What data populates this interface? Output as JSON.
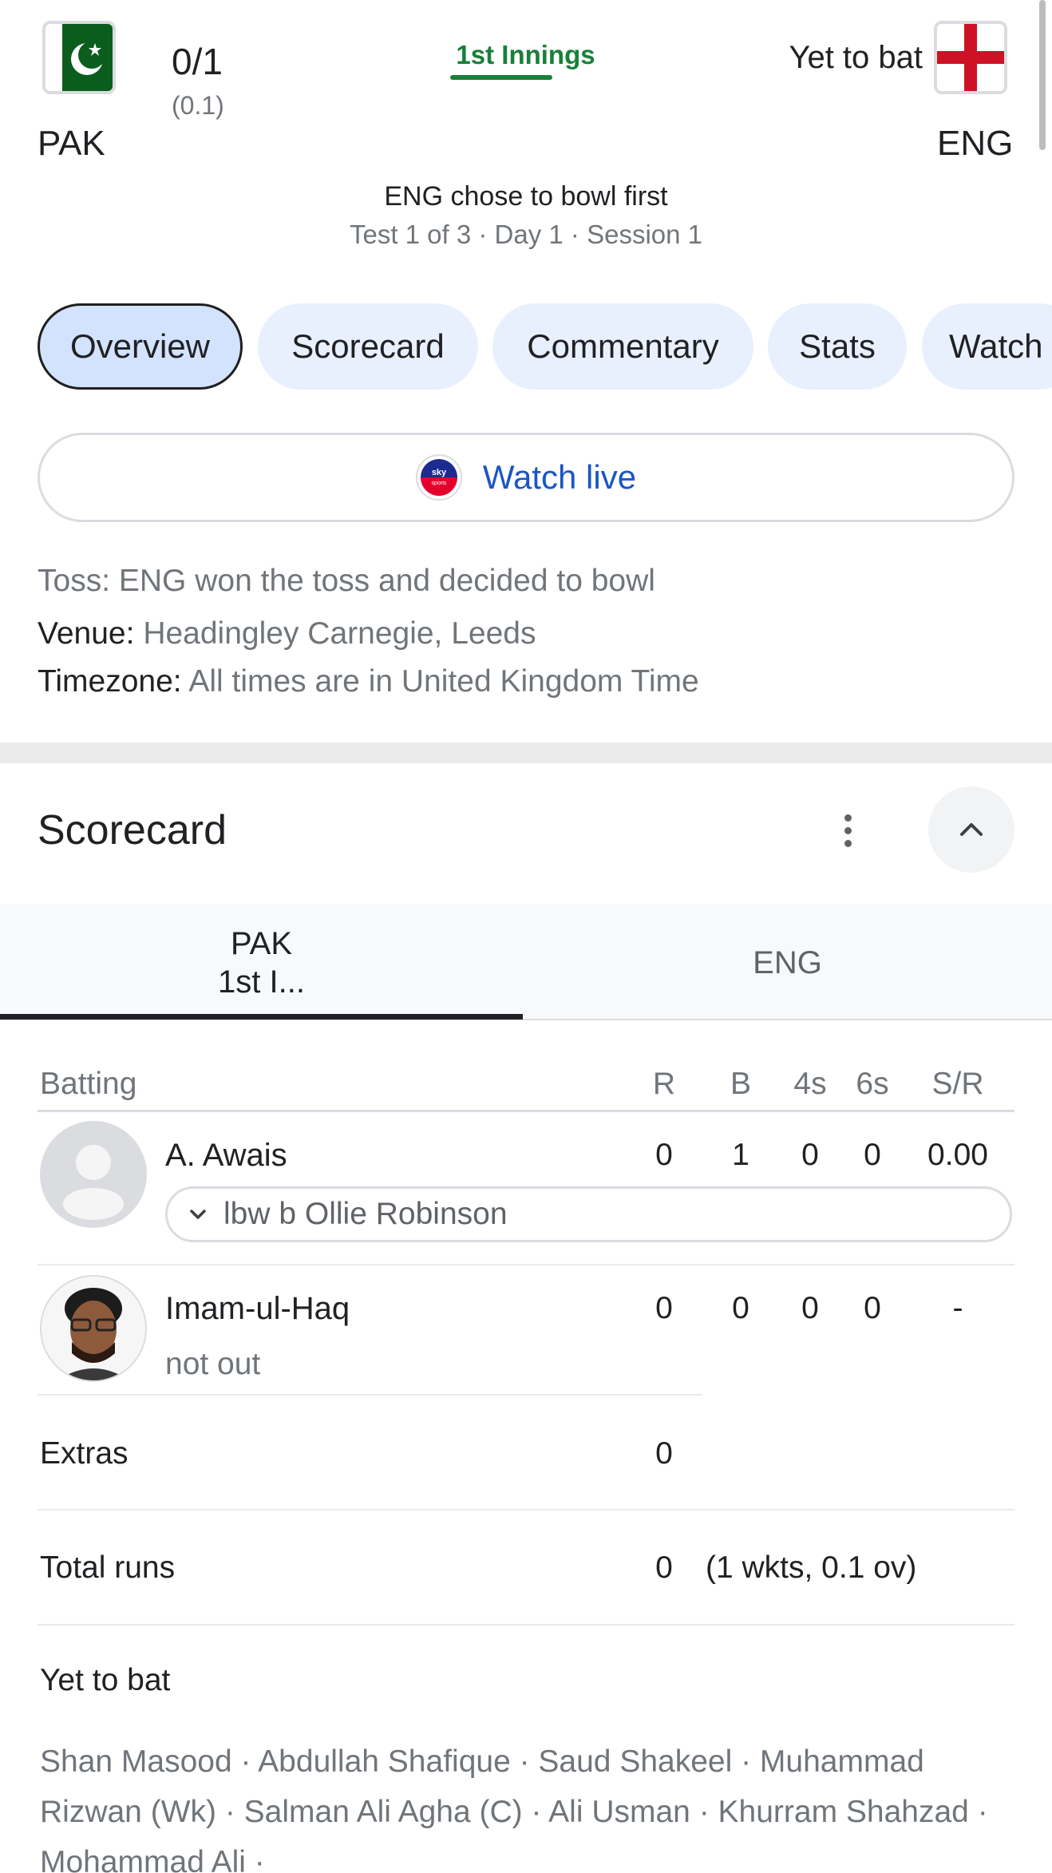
{
  "header": {
    "home": {
      "code": "PAK",
      "score": "0/1",
      "overs": "(0.1)"
    },
    "innings_tab": "1st Innings",
    "away": {
      "code": "ENG",
      "status": "Yet to bat"
    },
    "toss_line": "ENG chose to bowl first",
    "match_line": "Test 1 of 3 · Day 1 · Session 1"
  },
  "tabs": [
    "Overview",
    "Scorecard",
    "Commentary",
    "Stats",
    "Watch"
  ],
  "watch_live": {
    "label": "Watch live",
    "provider_logo_text": "sky sports"
  },
  "info": {
    "toss": {
      "label": "Toss:",
      "value": "ENG won the toss and decided to bowl"
    },
    "venue": {
      "label": "Venue:",
      "value": "Headingley Carnegie, Leeds"
    },
    "timezone": {
      "label": "Timezone:",
      "value": "All times are in United Kingdom Time"
    }
  },
  "scorecard": {
    "title": "Scorecard",
    "team_tabs": [
      {
        "line1": "PAK",
        "line2": "1st I..."
      },
      {
        "line1": "ENG",
        "line2": ""
      }
    ],
    "headers": {
      "batting": "Batting",
      "r": "R",
      "b": "B",
      "fours": "4s",
      "sixes": "6s",
      "sr": "S/R"
    },
    "batters": [
      {
        "name": "A. Awais",
        "r": "0",
        "b": "1",
        "fours": "0",
        "sixes": "0",
        "sr": "0.00",
        "dismissal": "lbw b Ollie Robinson"
      },
      {
        "name": "Imam-ul-Haq",
        "r": "0",
        "b": "0",
        "fours": "0",
        "sixes": "0",
        "sr": "-",
        "status": "not out"
      }
    ],
    "extras": {
      "label": "Extras",
      "value": "0"
    },
    "total": {
      "label": "Total runs",
      "value": "0",
      "detail": "(1 wkts, 0.1 ov)"
    },
    "yet_to_bat": {
      "label": "Yet to bat",
      "players": "Shan Masood · Abdullah Shafique · Saud Shakeel · Muhammad Rizwan (Wk) · Salman Ali Agha (C) · Ali Usman · Khurram Shahzad · Mohammad Ali ·"
    }
  },
  "colors": {
    "accent_green": "#188038",
    "chip_bg": "#e8f0fe",
    "chip_active_bg": "#d3e3fd",
    "link_blue": "#1a56c4"
  }
}
